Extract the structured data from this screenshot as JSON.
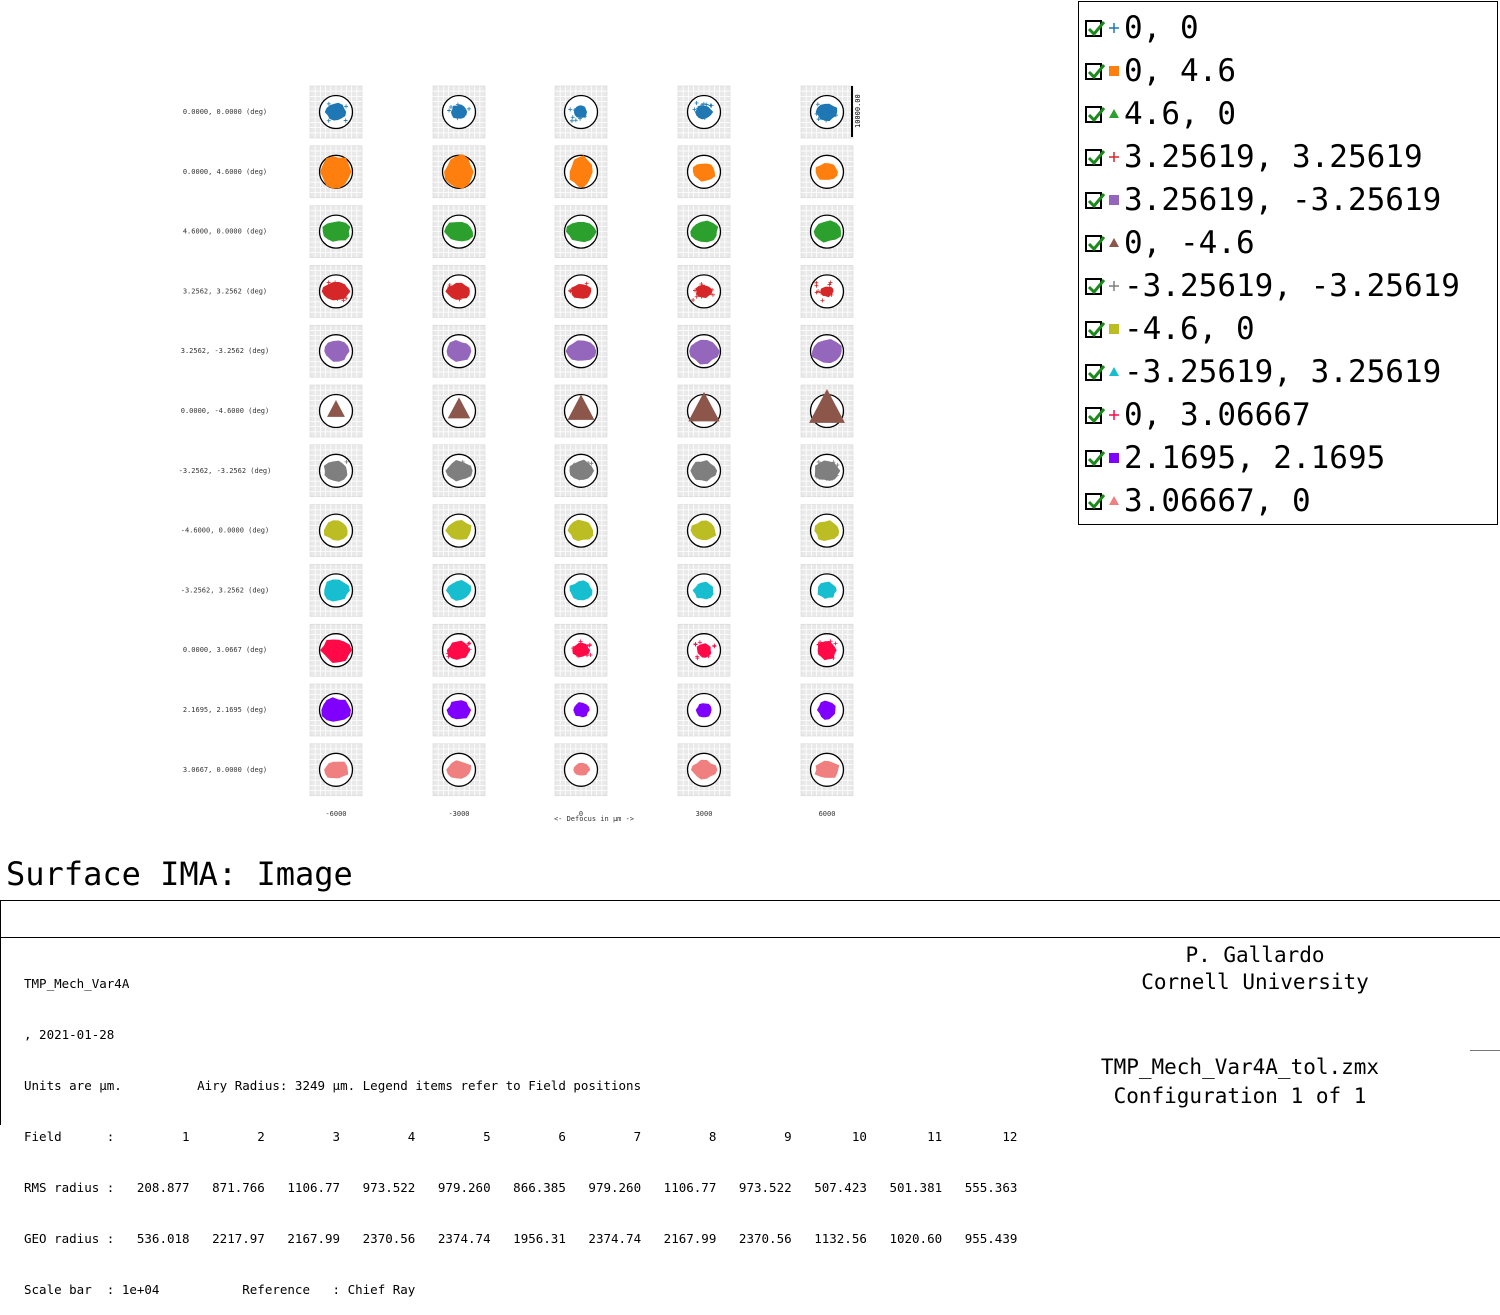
{
  "chart_data": {
    "type": "spot-diagram-matrix",
    "fields": [
      {
        "label": "0.0000, 0.0000 (deg)",
        "color": "#1f77b4",
        "marker": "cross"
      },
      {
        "label": "0.0000, 4.6000 (deg)",
        "color": "#ff7f0e",
        "marker": "square"
      },
      {
        "label": "4.6000, 0.0000 (deg)",
        "color": "#2ca02c",
        "marker": "triangle"
      },
      {
        "label": "3.2562, 3.2562 (deg)",
        "color": "#d62728",
        "marker": "cross"
      },
      {
        "label": "3.2562, -3.2562 (deg)",
        "color": "#9467bd",
        "marker": "square"
      },
      {
        "label": "0.0000, -4.6000 (deg)",
        "color": "#8c564b",
        "marker": "triangle"
      },
      {
        "label": "-3.2562, -3.2562 (deg)",
        "color": "#7f7f7f",
        "marker": "cross"
      },
      {
        "label": "-4.6000, 0.0000 (deg)",
        "color": "#bcbd22",
        "marker": "square"
      },
      {
        "label": "-3.2562, 3.2562 (deg)",
        "color": "#17becf",
        "marker": "triangle"
      },
      {
        "label": "0.0000, 3.0667 (deg)",
        "color": "#ff0a47",
        "marker": "cross"
      },
      {
        "label": "2.1695, 2.1695 (deg)",
        "color": "#8000ff",
        "marker": "square"
      },
      {
        "label": "3.0667, 0.0000 (deg)",
        "color": "#f08080",
        "marker": "triangle"
      }
    ],
    "defocus": [
      "-6000",
      "-3000",
      "0",
      "3000",
      "6000"
    ],
    "xlabel": "<- Defocus in µm ->",
    "scale_bar_label": "10000.00"
  },
  "legend": {
    "items": [
      {
        "text": "0, 0",
        "color": "#1f77b4",
        "marker": "cross"
      },
      {
        "text": "0, 4.6",
        "color": "#ff7f0e",
        "marker": "square"
      },
      {
        "text": "4.6, 0",
        "color": "#2ca02c",
        "marker": "triangle"
      },
      {
        "text": "3.25619, 3.25619",
        "color": "#d62728",
        "marker": "cross"
      },
      {
        "text": "3.25619, -3.25619",
        "color": "#9467bd",
        "marker": "square"
      },
      {
        "text": "0, -4.6",
        "color": "#8c564b",
        "marker": "triangle"
      },
      {
        "text": "-3.25619, -3.25619",
        "color": "#7f7f7f",
        "marker": "cross"
      },
      {
        "text": "-4.6, 0",
        "color": "#bcbd22",
        "marker": "square"
      },
      {
        "text": "-3.25619, 3.25619",
        "color": "#17becf",
        "marker": "triangle"
      },
      {
        "text": "0, 3.06667",
        "color": "#ff0a47",
        "marker": "cross"
      },
      {
        "text": "2.1695, 2.1695",
        "color": "#8000ff",
        "marker": "square"
      },
      {
        "text": "3.06667, 0",
        "color": "#f08080",
        "marker": "triangle"
      }
    ]
  },
  "surface_title": "Surface IMA: Image",
  "footer": {
    "lines": [
      "TMP_Mech_Var4A",
      ", 2021-01-28",
      "Units are µm.          Airy Radius: 3249 µm. Legend items refer to Field positions",
      "Field      :         1         2         3         4         5         6         7         8         9        10        11        12",
      "RMS radius :   208.877   871.766   1106.77   973.522   979.260   866.385   979.260   1106.77   973.522   507.423   501.381   555.363",
      "GEO radius :   536.018   2217.97   2167.99   2370.56   2374.74   1956.31   2374.74   2167.99   2370.56   1132.56   1020.60   955.439",
      "Scale bar  : 1e+04           Reference   : Chief Ray"
    ],
    "author": "P. Gallardo",
    "institution": "Cornell University",
    "filename": "TMP_Mech_Var4A_tol.zmx",
    "configuration": "Configuration 1 of 1"
  }
}
